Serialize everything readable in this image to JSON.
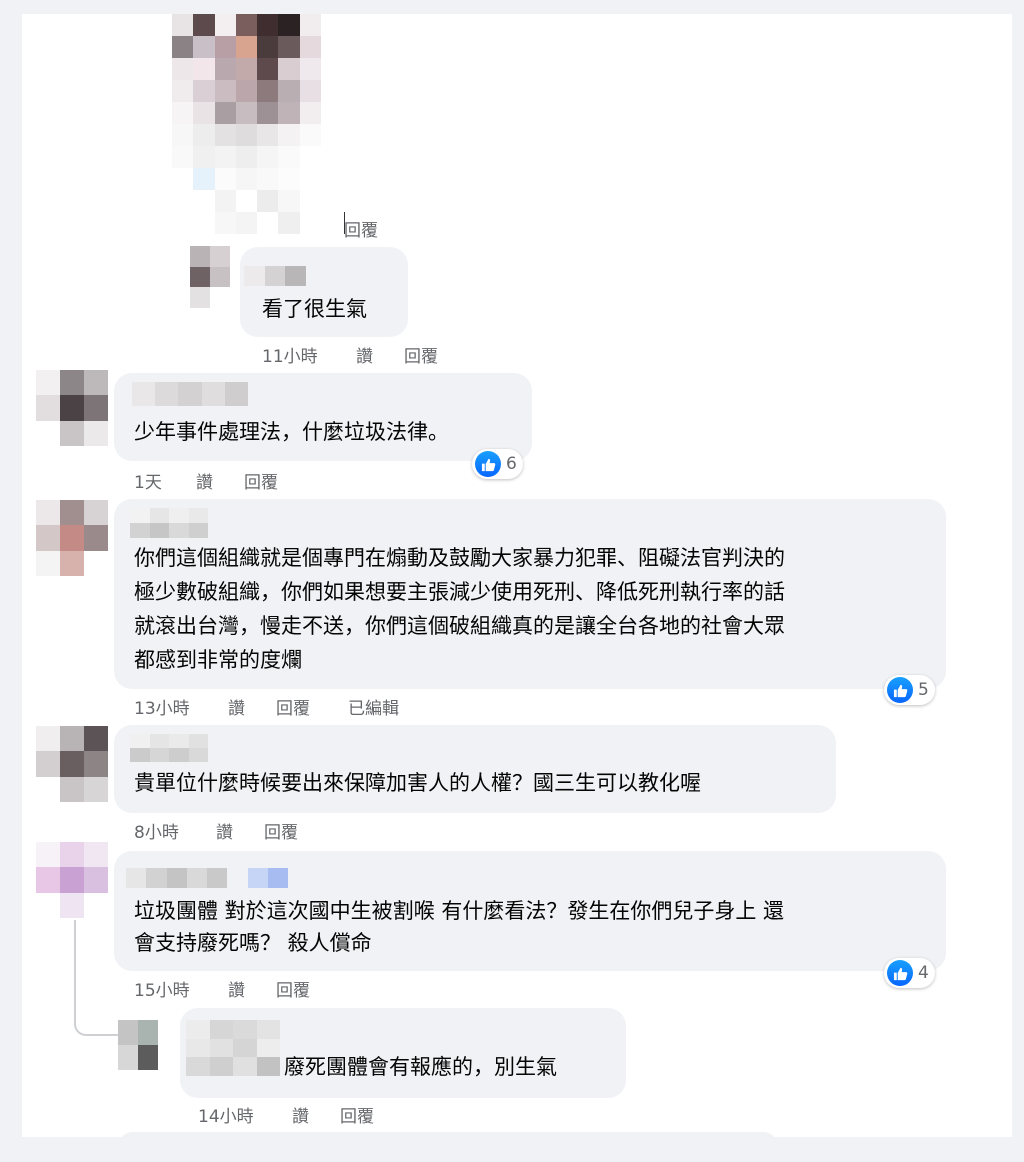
{
  "actions": {
    "reply": "回覆",
    "like": "讚",
    "edited": "已編輯"
  },
  "comments": [
    {
      "text": "看了很生氣",
      "time": "11小時"
    },
    {
      "text": "少年事件處理法，什麼垃圾法律。",
      "time": "1天",
      "likes": "6"
    },
    {
      "lines": [
        "你們這個組織就是個專門在煽動及鼓勵大家暴力犯罪、阻礙法官判決的",
        "極少數破組織，你們如果想要主張減少使用死刑、降低死刑執行率的話",
        "就滾出台灣，慢走不送，你們這個破組織真的是讓全台各地的社會大眾",
        "都感到非常的度爛"
      ],
      "time": "13小時",
      "likes": "5"
    },
    {
      "text": "貴單位什麼時候要出來保障加害人的人權？國三生可以教化喔",
      "time": "8小時"
    },
    {
      "lines": [
        "垃圾團體 對於這次國中生被割喉 有什麼看法？發生在你們兒子身上 還",
        "會支持廢死嗎？ 殺人償命"
      ],
      "time": "15小時",
      "likes": "4"
    },
    {
      "text": "廢死團體會有報應的，別生氣",
      "time": "14小時"
    }
  ],
  "colors": {
    "bubble": "#f0f2f5",
    "meta": "#65676b",
    "like_blue": "#0866ff"
  },
  "icons": {
    "like": "like-thumbs-up-icon"
  }
}
